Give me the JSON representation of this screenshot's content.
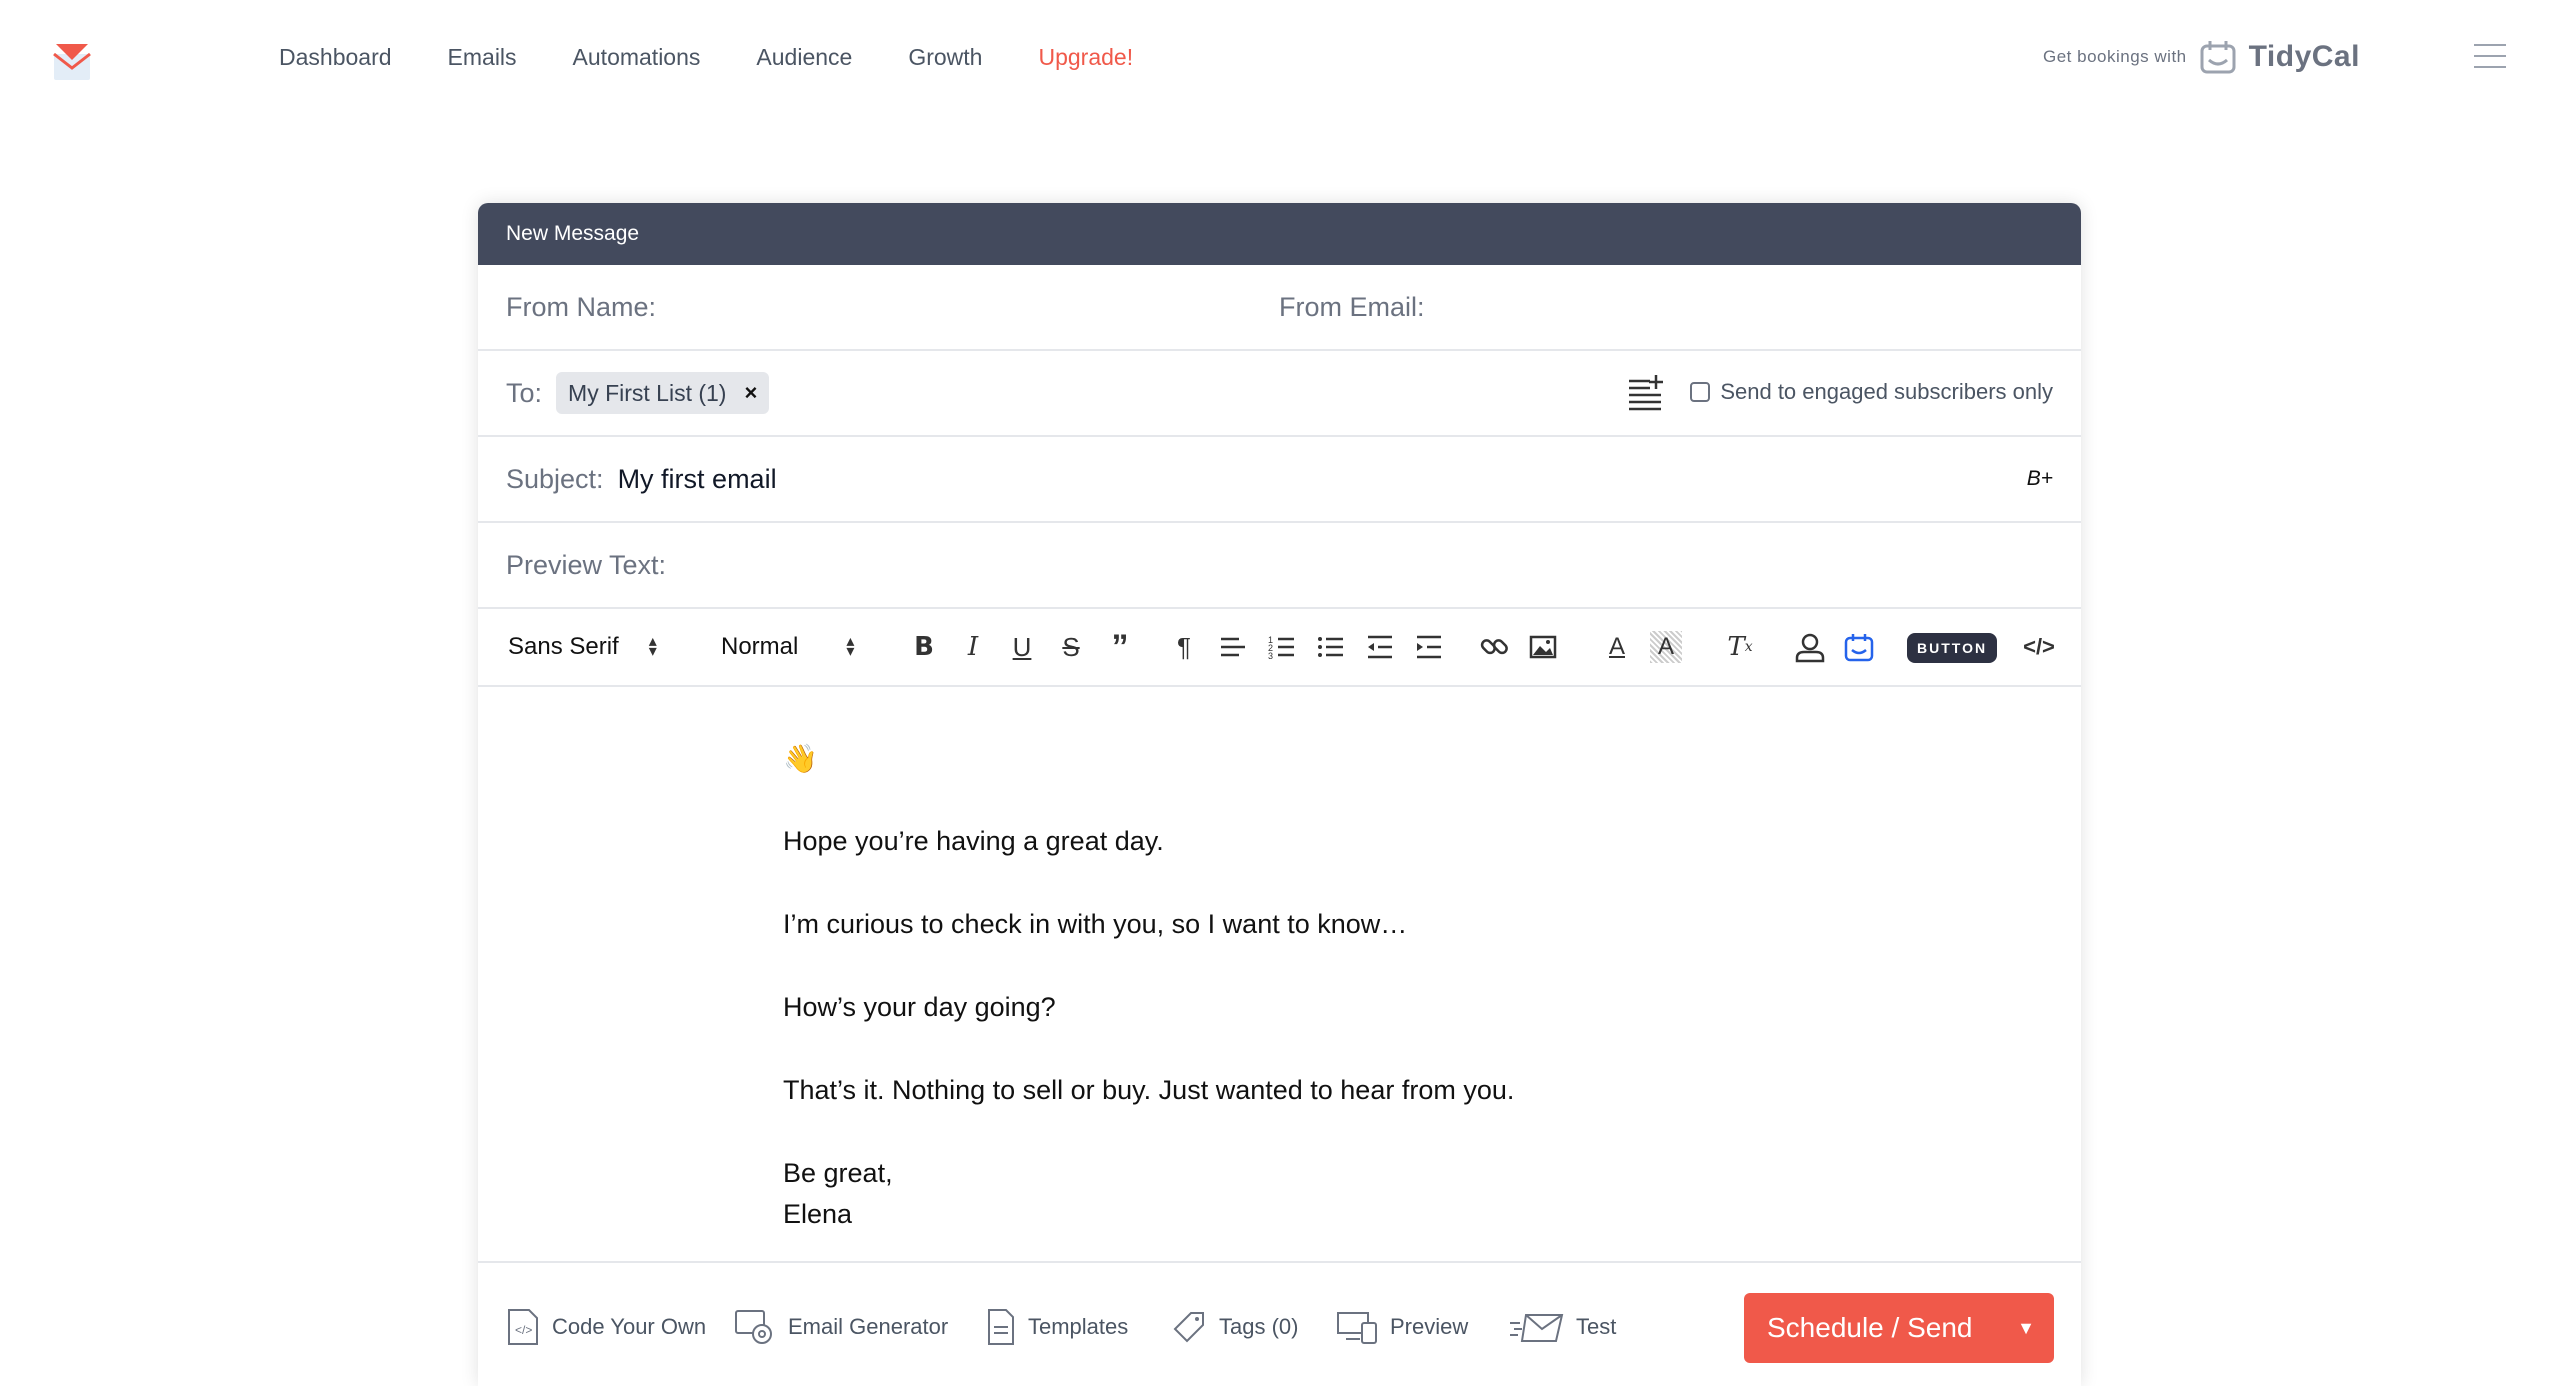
{
  "nav": {
    "links": [
      "Dashboard",
      "Emails",
      "Automations",
      "Audience",
      "Growth"
    ],
    "upgrade": "Upgrade!",
    "tidycal_prefix": "Get bookings with",
    "tidycal_brand": "TidyCal"
  },
  "composer": {
    "header": "New Message",
    "from_name_label": "From Name:",
    "from_email_label": "From Email:",
    "to_label": "To:",
    "to_chip": "My First List (1)",
    "to_chip_remove": "×",
    "engaged_label": "Send to engaged subscribers only",
    "subject_label": "Subject:",
    "subject_value": "My first email",
    "subject_tool": "B+",
    "preview_label": "Preview Text:",
    "toolbar": {
      "font": "Sans Serif",
      "size": "Normal",
      "button_label": "BUTTON"
    },
    "body": {
      "emoji": "👋",
      "line1": "Hope you’re having a great day.",
      "line2": "I’m curious to check in with you, so I want to know…",
      "line3": "How’s your day going?",
      "line4": "That’s it. Nothing to sell or buy. Just wanted to hear from you.",
      "sign1": "Be great,",
      "sign2": "Elena"
    },
    "footer": {
      "code_your_own": "Code Your Own",
      "email_generator": "Email Generator",
      "templates": "Templates",
      "tags": "Tags (0)",
      "preview": "Preview",
      "test": "Test",
      "send": "Schedule / Send"
    }
  },
  "colors": {
    "accent": "#f0594a",
    "header": "#434a5d"
  }
}
